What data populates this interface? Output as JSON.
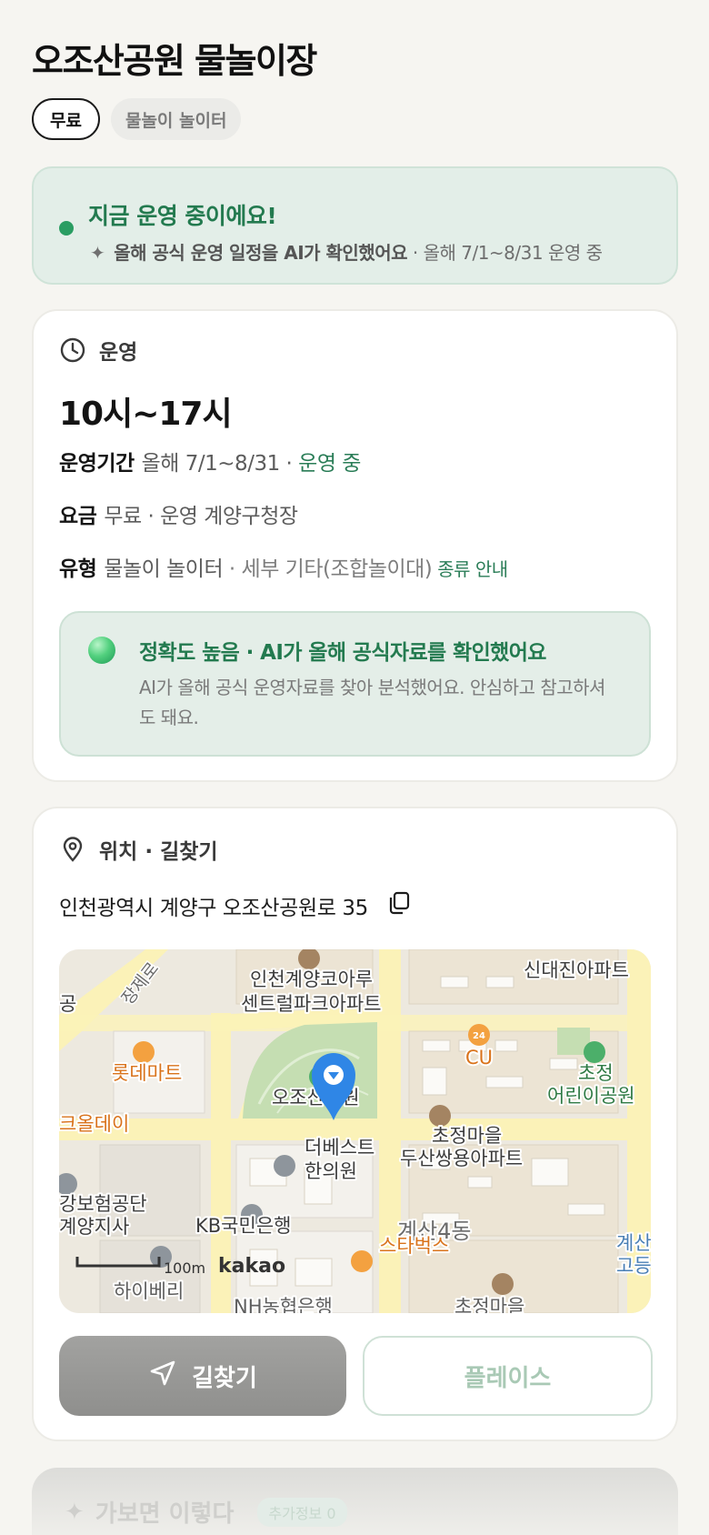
{
  "page": {
    "title": "오조산공원 물놀이장"
  },
  "chips": [
    {
      "label": "무료"
    },
    {
      "label": "물놀이 놀이터"
    }
  ],
  "status": {
    "headline": "지금 운영 중이에요!",
    "ai_note": "올해 공식 운영 일정을 AI가 확인했어요",
    "period_note": "· 올해 7/1~8/31 운영 중"
  },
  "operation": {
    "section_label": "운영",
    "hours": "10시~17시",
    "period_key": "운영기간",
    "period_value": "올해 7/1~8/31 ·",
    "period_status": "운영 중",
    "fee_key": "요금",
    "fee_value": "무료 · 운영 계양구청장",
    "type_key": "유형",
    "type_value": "물놀이 놀이터",
    "type_detail": "· 세부 기타(조합놀이대)",
    "type_link": "종류 안내",
    "accuracy_title": "정확도 높음 · AI가 올해 공식자료를 확인했어요",
    "accuracy_body": "AI가 올해 공식 운영자료를 찾아 분석했어요. 안심하고 참고하셔도 돼요."
  },
  "location": {
    "section_label": "위치 · 길찾기",
    "address": "인천광역시 계양구 오조산공원로 35"
  },
  "map": {
    "labels": {
      "apt1a": "인천계양코아루",
      "apt1b": "센트럴파크아파트",
      "apt2": "신대진아파트",
      "lotte": "롯데마트",
      "cu": "CU",
      "cu_badge": "24",
      "park": "오조산공원",
      "playground_a": "초정",
      "playground_b": "어린이공원",
      "olday": "크올데이",
      "clinic_a": "더베스트",
      "clinic_b": "한의원",
      "apt3a": "초정마을",
      "apt3b": "두산쌍용아파트",
      "ins_a": "강보험공단",
      "ins_b": "계양지사",
      "kb": "KB국민은행",
      "dong": "계산4동",
      "starbucks": "스타벅스",
      "road": "장제로",
      "gong": "공",
      "scale": "100m",
      "brand": "kakao",
      "nh": "NH농협은행",
      "hi": "하이베리",
      "chojeong2": "초정마을",
      "edge_a": "계산",
      "edge_b": "고등"
    }
  },
  "buttons": {
    "directions": "길찾기",
    "places": "플레이스"
  },
  "next_section": {
    "title": "가보면 이렇다",
    "badge": "추가정보 0"
  }
}
